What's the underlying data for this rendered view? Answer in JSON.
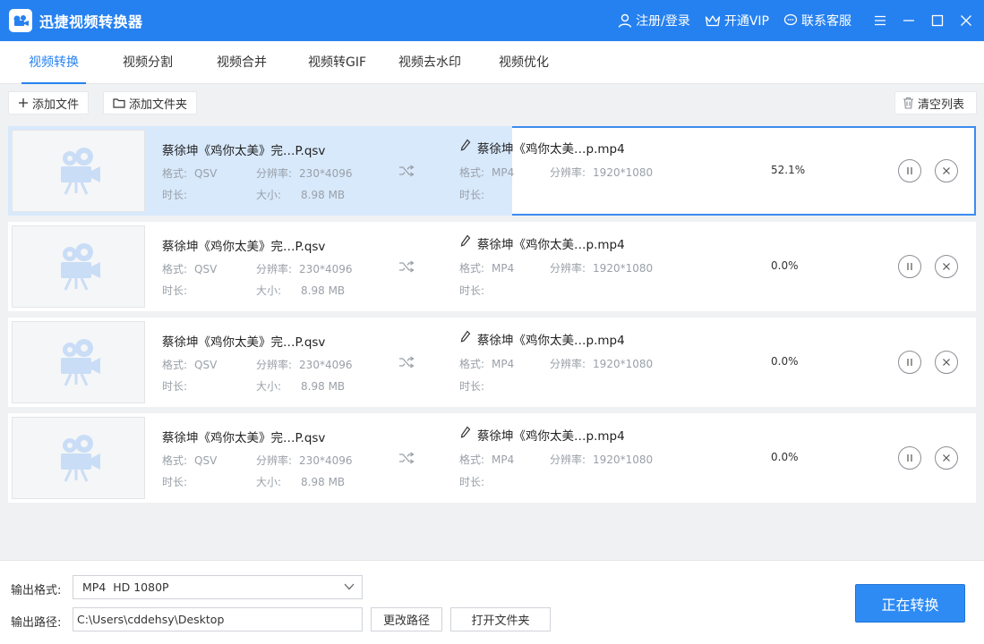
{
  "app": {
    "title": "迅捷视频转换器"
  },
  "header": {
    "login": "注册/登录",
    "vip": "开通VIP",
    "service": "联系客服"
  },
  "tabs": [
    {
      "label": "视频转换",
      "active": true
    },
    {
      "label": "视频分割"
    },
    {
      "label": "视频合并"
    },
    {
      "label": "视频转GIF"
    },
    {
      "label": "视频去水印"
    },
    {
      "label": "视频优化"
    }
  ],
  "toolbar": {
    "add_file": "添加文件",
    "add_folder": "添加文件夹",
    "clear_list": "清空列表"
  },
  "labels": {
    "format": "格式:",
    "resolution": "分辨率:",
    "duration": "时长:",
    "size": "大小:"
  },
  "files": [
    {
      "src_name": "蔡徐坤《鸡你太美》完…P.qsv",
      "src_format": "QSV",
      "src_resolution": "230*4096",
      "src_size": "8.98 MB",
      "dst_name": "蔡徐坤《鸡你太美…p.mp4",
      "dst_format": "MP4",
      "dst_resolution": "1920*1080",
      "progress": 52.1,
      "progress_text": "52.1%"
    },
    {
      "src_name": "蔡徐坤《鸡你太美》完…P.qsv",
      "src_format": "QSV",
      "src_resolution": "230*4096",
      "src_size": "8.98 MB",
      "dst_name": "蔡徐坤《鸡你太美…p.mp4",
      "dst_format": "MP4",
      "dst_resolution": "1920*1080",
      "progress": 0,
      "progress_text": "0.0%"
    },
    {
      "src_name": "蔡徐坤《鸡你太美》完…P.qsv",
      "src_format": "QSV",
      "src_resolution": "230*4096",
      "src_size": "8.98 MB",
      "dst_name": "蔡徐坤《鸡你太美…p.mp4",
      "dst_format": "MP4",
      "dst_resolution": "1920*1080",
      "progress": 0,
      "progress_text": "0.0%"
    },
    {
      "src_name": "蔡徐坤《鸡你太美》完…P.qsv",
      "src_format": "QSV",
      "src_resolution": "230*4096",
      "src_size": "8.98 MB",
      "dst_name": "蔡徐坤《鸡你太美…p.mp4",
      "dst_format": "MP4",
      "dst_resolution": "1920*1080",
      "progress": 0,
      "progress_text": "0.0%"
    }
  ],
  "bottom": {
    "format_label": "输出格式:",
    "format_value": "MP4  HD 1080P",
    "path_label": "输出路径:",
    "path_value": "C:\\Users\\cddehsy\\Desktop",
    "change_path": "更改路径",
    "open_folder": "打开文件夹",
    "start": "正在转换"
  },
  "colors": {
    "accent": "#2681f0",
    "progress_fill": "#d8e9fc",
    "placeholder_icon": "#c9ddf6"
  }
}
